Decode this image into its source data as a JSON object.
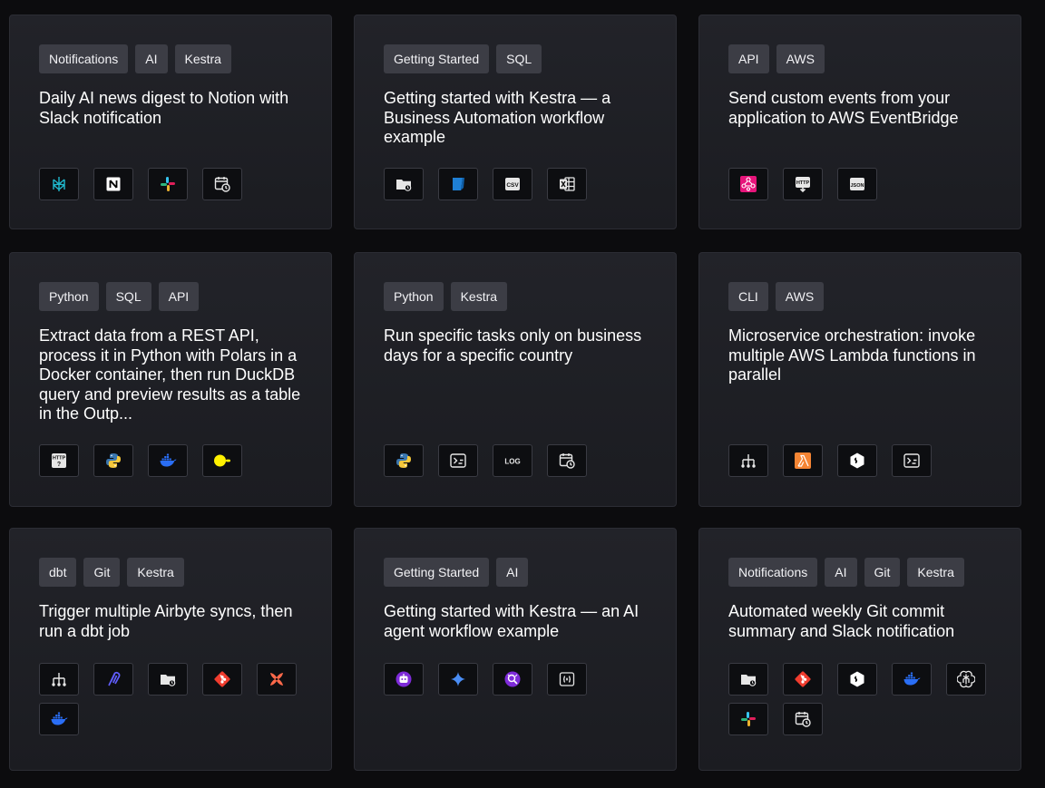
{
  "cards": [
    {
      "tags": [
        "Notifications",
        "AI",
        "Kestra"
      ],
      "title": "Daily AI news digest to Notion with Slack notification",
      "icons": [
        "perplexity-icon",
        "notion-icon",
        "slack-icon",
        "schedule-icon"
      ]
    },
    {
      "tags": [
        "Getting Started",
        "SQL"
      ],
      "title": "Getting started with Kestra — a Business Automation workflow example",
      "icons": [
        "folder-icon",
        "sqlite-icon",
        "csv-icon",
        "excel-icon"
      ]
    },
    {
      "tags": [
        "API",
        "AWS"
      ],
      "title": "Send custom events from your application to AWS EventBridge",
      "icons": [
        "aws-eventbridge-icon",
        "http-download-icon",
        "json-icon"
      ]
    },
    {
      "tags": [
        "Python",
        "SQL",
        "API"
      ],
      "title": "Extract data from a REST API, process it in Python with Polars in a Docker container, then run DuckDB query and preview results as a table in the Outp...",
      "icons": [
        "http-request-icon",
        "python-icon",
        "docker-icon",
        "duckdb-icon"
      ]
    },
    {
      "tags": [
        "Python",
        "Kestra"
      ],
      "title": "Run specific tasks only on business days for a specific country",
      "icons": [
        "python-icon",
        "script-icon",
        "log-icon",
        "schedule-icon"
      ]
    },
    {
      "tags": [
        "CLI",
        "AWS"
      ],
      "title": "Microservice orchestration: invoke multiple AWS Lambda functions in parallel",
      "icons": [
        "parallel-flow-icon",
        "aws-lambda-icon",
        "shell-icon",
        "script-icon"
      ]
    },
    {
      "tags": [
        "dbt",
        "Git",
        "Kestra"
      ],
      "title": "Trigger multiple Airbyte syncs, then run a dbt job",
      "icons": [
        "parallel-flow-icon",
        "airbyte-icon",
        "folder-icon",
        "git-icon",
        "dbt-icon",
        "docker-icon"
      ]
    },
    {
      "tags": [
        "Getting Started",
        "AI"
      ],
      "title": "Getting started with Kestra — an AI agent workflow example",
      "icons": [
        "ai-agent-icon",
        "gemini-icon",
        "web-search-icon",
        "variable-icon"
      ]
    },
    {
      "tags": [
        "Notifications",
        "AI",
        "Git",
        "Kestra"
      ],
      "title": "Automated weekly Git commit summary and Slack notification",
      "icons": [
        "folder-icon",
        "git-icon",
        "shell-icon",
        "docker-icon",
        "openai-icon",
        "slack-icon",
        "schedule-icon"
      ]
    }
  ],
  "colors": {
    "background": "#0c0c0e",
    "card": "#1e1f24",
    "tag": "#3c3d45"
  }
}
